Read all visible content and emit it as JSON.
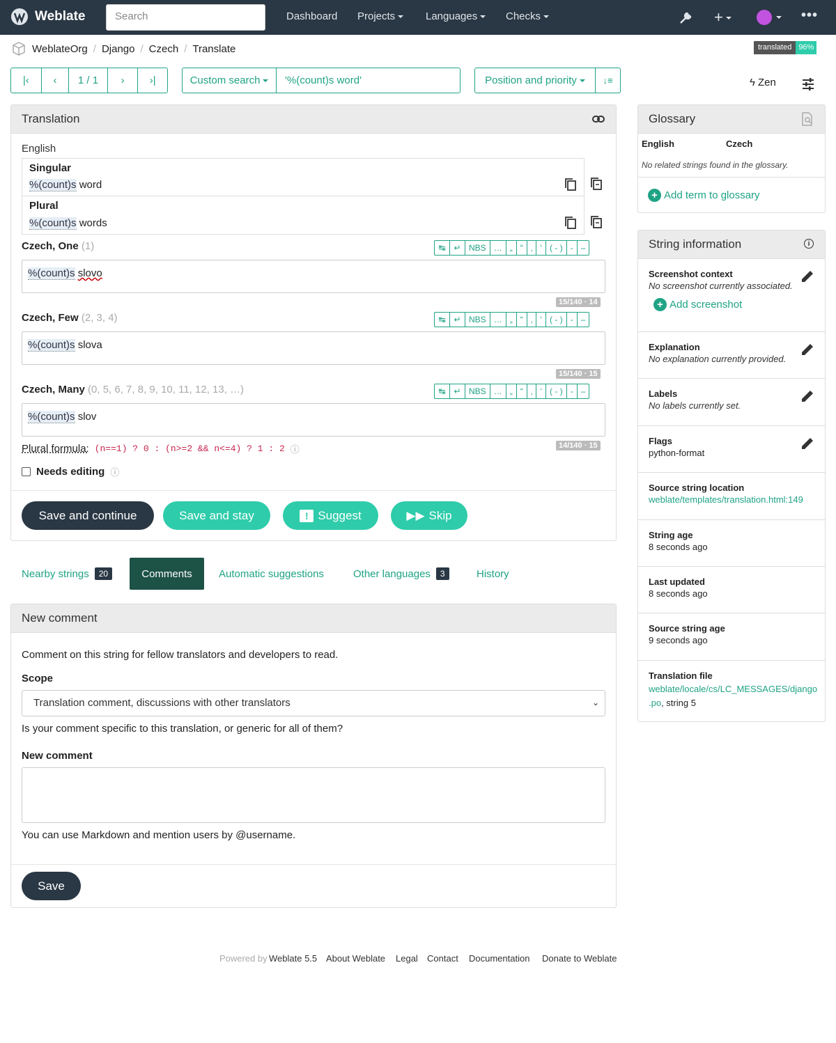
{
  "topbar": {
    "brand": "Weblate",
    "search_placeholder": "Search",
    "nav": [
      "Dashboard",
      "Projects",
      "Languages",
      "Checks"
    ]
  },
  "breadcrumb": [
    "WeblateOrg",
    "Django",
    "Czech",
    "Translate"
  ],
  "status_badge": {
    "label": "translated",
    "value": "96%"
  },
  "pager": {
    "position": "1 / 1"
  },
  "search": {
    "mode": "Custom search",
    "query": "'%(count)s word'"
  },
  "sort": {
    "label": "Position and priority"
  },
  "zen": "Zen",
  "translation_panel": {
    "title": "Translation",
    "source_lang": "English",
    "singular_label": "Singular",
    "singular_placeholder": "%(count)s",
    "singular_text": "word",
    "plural_label": "Plural",
    "plural_placeholder": "%(count)s",
    "plural_text": "words",
    "forms": [
      {
        "label": "Czech, One",
        "numbers": "(1)",
        "placeholder": "%(count)s",
        "text": "slovo",
        "counter": "15/140 · 14"
      },
      {
        "label": "Czech, Few",
        "numbers": "(2, 3, 4)",
        "placeholder": "%(count)s",
        "text": "slova",
        "counter": "15/140 · 15"
      },
      {
        "label": "Czech, Many",
        "numbers": "(0, 5, 6, 7, 8, 9, 10, 11, 12, 13, …)",
        "placeholder": "%(count)s",
        "text": "slov",
        "counter": "14/140 · 15"
      }
    ],
    "toolbar": [
      "NBS",
      "…",
      "„",
      "“",
      "‚",
      "‘",
      "( - )",
      "-",
      "–"
    ],
    "plural_formula_label": "Plural formula:",
    "plural_formula": "(n==1) ? 0 : (n>=2 && n<=4) ? 1 : 2",
    "needs_editing": "Needs editing",
    "buttons": {
      "save_continue": "Save and continue",
      "save_stay": "Save and stay",
      "suggest": "Suggest",
      "skip": "Skip"
    }
  },
  "tabs": [
    {
      "label": "Nearby strings",
      "count": "20"
    },
    {
      "label": "Comments"
    },
    {
      "label": "Automatic suggestions"
    },
    {
      "label": "Other languages",
      "count": "3"
    },
    {
      "label": "History"
    }
  ],
  "comment_panel": {
    "title": "New comment",
    "intro": "Comment on this string for fellow translators and developers to read.",
    "scope_label": "Scope",
    "scope_value": "Translation comment, discussions with other translators",
    "scope_help": "Is your comment specific to this translation, or generic for all of them?",
    "comment_label": "New comment",
    "markdown_help": "You can use Markdown and mention users by @username.",
    "save": "Save"
  },
  "glossary": {
    "title": "Glossary",
    "col_source": "English",
    "col_target": "Czech",
    "empty": "No related strings found in the glossary.",
    "add": "Add term to glossary"
  },
  "string_info": {
    "title": "String information",
    "screenshot_title": "Screenshot context",
    "screenshot_value": "No screenshot currently associated.",
    "add_screenshot": "Add screenshot",
    "explanation_title": "Explanation",
    "explanation_value": "No explanation currently provided.",
    "labels_title": "Labels",
    "labels_value": "No labels currently set.",
    "flags_title": "Flags",
    "flags_value": "python-format",
    "location_title": "Source string location",
    "location_value": "weblate/templates/translation.html:149",
    "age_title": "String age",
    "age_value": "8 seconds ago",
    "updated_title": "Last updated",
    "updated_value": "8 seconds ago",
    "source_age_title": "Source string age",
    "source_age_value": "9 seconds ago",
    "file_title": "Translation file",
    "file_link_1": "weblate/locale/cs/LC_MESSAGES/django",
    "file_link_2": ".po",
    "file_suffix": ", string 5"
  },
  "footer": {
    "powered_by": "Powered by",
    "version": "Weblate 5.5",
    "links": [
      "About Weblate",
      "Legal",
      "Contact",
      "Documentation",
      "Donate to Weblate"
    ]
  },
  "colors": {
    "accent": "#1fa385",
    "navbar": "#2a3744",
    "button_dark": "#2a3744",
    "button_teal": "#2eccaa"
  }
}
